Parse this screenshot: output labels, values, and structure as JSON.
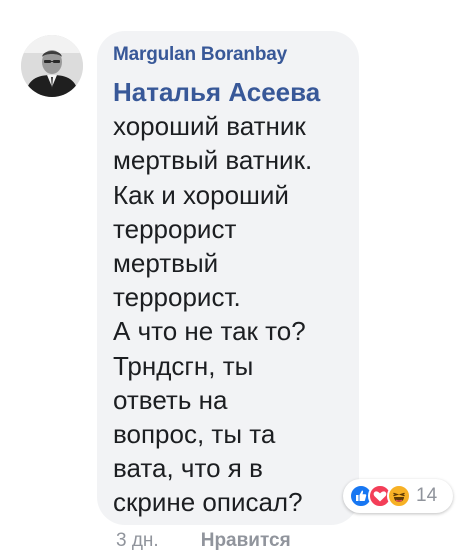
{
  "comment": {
    "author": "Margulan Boranbay",
    "mention": "Наталья Асеева",
    "lines": [
      "хороший ватник",
      "мертвый ватник.",
      "Как и хороший",
      "террорист",
      "мертвый",
      "террорист.",
      "А что не так то?",
      "Трндсгн, ты",
      "ответь на",
      "вопрос, ты та",
      "вата, что я в",
      "скрине описал?"
    ],
    "reactions": {
      "icons": [
        "like-icon",
        "love-icon",
        "haha-icon"
      ],
      "count": "14"
    },
    "timestamp": "3 дн.",
    "like_action": "Нравится"
  },
  "colors": {
    "author": "#385898",
    "bubble": "#f2f3f5",
    "like": "#1877f2",
    "love": "#f33e58",
    "haha": "#f7b125",
    "meta": "#90949c"
  }
}
